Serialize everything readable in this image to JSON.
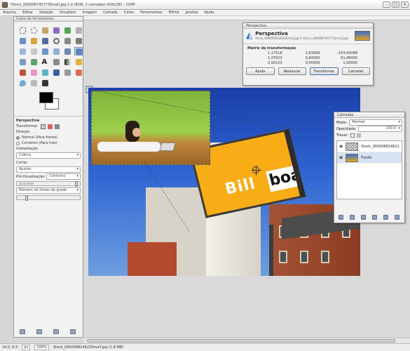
{
  "window": {
    "title": "*Stock_000006745773Small.jpg-1.0 (RGB, 2 camadas) 428x282 – GIMP"
  },
  "menu": [
    "Arquivo",
    "Editar",
    "Seleção",
    "Visualizar",
    "Imagem",
    "Camada",
    "Cores",
    "Ferramentas",
    "Filtros",
    "Janelas",
    "Ajuda"
  ],
  "toolbox": {
    "title": "Caixa de ferramentas",
    "tool_options_title": "Perspectiva",
    "transform_label": "Transformar:",
    "direction_label": "Direção",
    "direction_normal": "Normal (Para frente)",
    "direction_corrective": "Corretivo (Para trás)",
    "interpolation_label": "Interpolação",
    "interpolation_value": "Cúbica",
    "clipping_label": "Cortar",
    "clipping_value": "Ajustar",
    "preview_label": "Pré-Visualização",
    "preview_value": "Contorno",
    "opacity_label": "Opacidade",
    "opacity_value": "100.0",
    "guides_value": "Número de linhas de grade"
  },
  "dialog": {
    "title": "Perspectiva",
    "heading": "Perspectiva",
    "subtitle": "Stock_000006814622Small.jpg-5 (Stock_000006745773Small.jpg)",
    "matrix_title": "Matriz de transformação",
    "matrix": [
      [
        "1,17518",
        "2,83958",
        "-154,44288"
      ],
      [
        "1,07020",
        "0,64083",
        "61,48400"
      ],
      [
        "0,00123",
        "0,00009",
        "1,00000"
      ]
    ],
    "buttons": {
      "help": "Ajuda",
      "reset": "Restaurar",
      "transform": "Transformar",
      "cancel": "Cancelar"
    }
  },
  "layers": {
    "title": "Camadas",
    "mode_label": "Modo:",
    "mode_value": "Normal",
    "opacity_label": "Opacidade:",
    "opacity_value": "100.0",
    "lock_label": "Travar:",
    "items": [
      {
        "name": "Stock_000006814622"
      },
      {
        "name": "Fundo"
      }
    ]
  },
  "image": {
    "billboard_text_1": "Bill",
    "billboard_text_2": "board"
  },
  "status": {
    "coords": "24.0, 8.5",
    "unit": "px",
    "zoom": "100%",
    "info": "Stock_000006814622Small.jpg (1,8 MB)"
  }
}
